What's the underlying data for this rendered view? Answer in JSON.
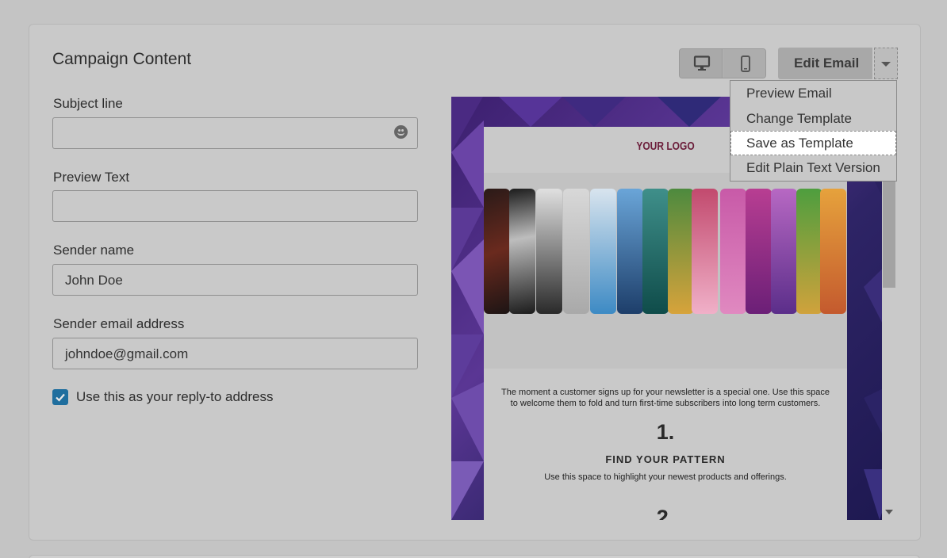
{
  "section": {
    "title": "Campaign Content"
  },
  "form": {
    "subject_label": "Subject line",
    "subject_value": "",
    "preview_label": "Preview Text",
    "preview_value": "",
    "sender_name_label": "Sender name",
    "sender_name_value": "John Doe",
    "sender_email_label": "Sender email address",
    "sender_email_value": "johndoe@gmail.com",
    "reply_to_label": "Use this as your reply-to address",
    "reply_to_checked": true
  },
  "toolbar": {
    "edit_label": "Edit Email",
    "desktop_icon": "desktop-icon",
    "mobile_icon": "mobile-icon"
  },
  "dropdown": {
    "items": [
      {
        "label": "Preview Email"
      },
      {
        "label": "Change Template"
      },
      {
        "label": "Save as Template"
      },
      {
        "label": "Edit Plain Text Version"
      }
    ],
    "active_index": 2
  },
  "email_preview": {
    "logo": "YOUR LOGO",
    "intro": "The moment a customer signs up for your newsletter is a special one. Use this space to welcome them to fold and turn first-time subscribers into long term customers.",
    "step1_number": "1.",
    "step1_title": "FIND YOUR PATTERN",
    "step1_text": "Use this space to highlight your newest products and offerings.",
    "step2_number": "2."
  },
  "colors": {
    "overlay_bg": "#c4c4c4",
    "checkbox": "#1f6e9e",
    "logo": "#6b1d3a",
    "highlight": "#ffffff"
  }
}
